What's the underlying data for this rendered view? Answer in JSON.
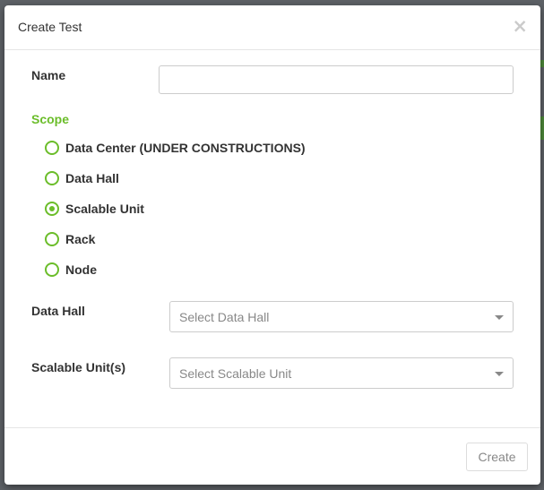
{
  "modal": {
    "title": "Create Test",
    "close_glyph": "×"
  },
  "form": {
    "name_label": "Name",
    "name_value": "",
    "scope_heading": "Scope",
    "scope_options": [
      {
        "label": "Data Center (UNDER CONSTRUCTIONS)",
        "checked": false
      },
      {
        "label": "Data Hall",
        "checked": false
      },
      {
        "label": "Scalable Unit",
        "checked": true
      },
      {
        "label": "Rack",
        "checked": false
      },
      {
        "label": "Node",
        "checked": false
      }
    ],
    "data_hall_label": "Data Hall",
    "data_hall_placeholder": "Select Data Hall",
    "scalable_unit_label": "Scalable Unit(s)",
    "scalable_unit_placeholder": "Select Scalable Unit"
  },
  "footer": {
    "create_label": "Create"
  },
  "colors": {
    "accent": "#6bbd2a",
    "overlay": "#5d6166"
  },
  "icons": {
    "close": "close-icon",
    "dropdown": "caret-down-icon",
    "radio_selected": "radio-checked-icon",
    "radio_unselected": "radio-unchecked-icon"
  }
}
